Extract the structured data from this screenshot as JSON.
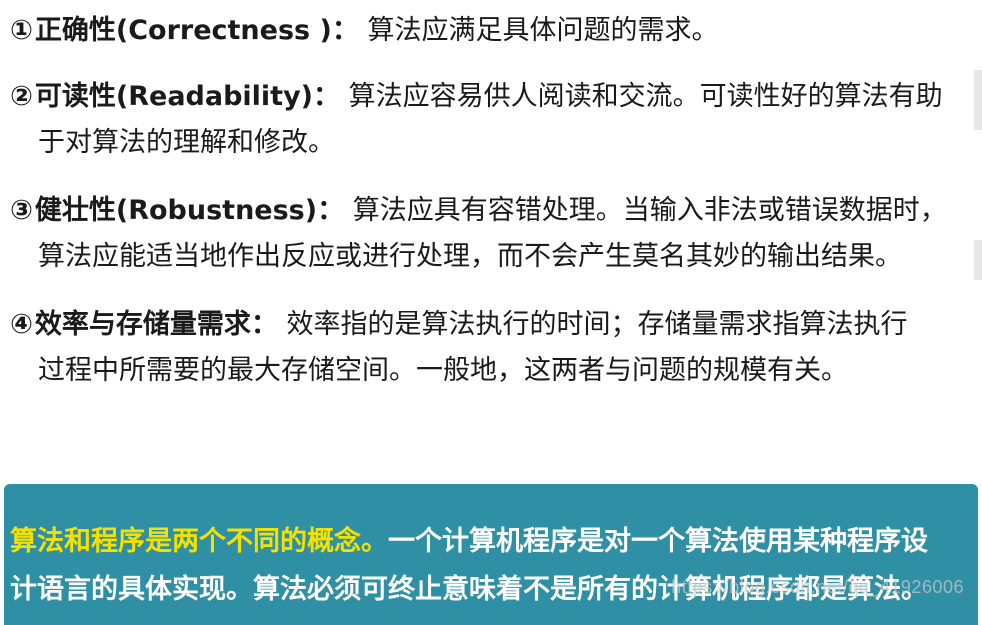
{
  "items": [
    {
      "number": "①",
      "heading": "正确性(Correctness )：",
      "line1": "算法应满足具体问题的需求。",
      "line2": ""
    },
    {
      "number": "②",
      "heading": "可读性(Readability)：",
      "line1": "算法应容易供人阅读和交流。可读性好的算法有助",
      "line2": "于对算法的理解和修改。"
    },
    {
      "number": "③",
      "heading": "健壮性(Robustness)：",
      "line1": "算法应具有容错处理。当输入非法或错误数据时，",
      "line2": "算法应能适当地作出反应或进行处理，而不会产生莫名其妙的输出结果。"
    },
    {
      "number": "④",
      "heading": "效率与存储量需求：",
      "line1": "效率指的是算法执行的时间；存储量需求指算法执行",
      "line2": "过程中所需要的最大存储空间。一般地，这两者与问题的规模有关。"
    }
  ],
  "callout": {
    "highlight": "算法和程序是两个不同的概念。",
    "rest_line1": "一个计算机程序是对一个算法使用某种程序设",
    "line2": "计语言的具体实现。算法必须可终止意味着不是所有的计算机程序都是算法。"
  },
  "watermark": "https://blog.csdn.net/qq_41926006",
  "colors": {
    "callout_background": "#2e8fa5",
    "callout_highlight": "#f5e100",
    "callout_text": "#ffffff",
    "body_text": "#1a1a1a"
  }
}
